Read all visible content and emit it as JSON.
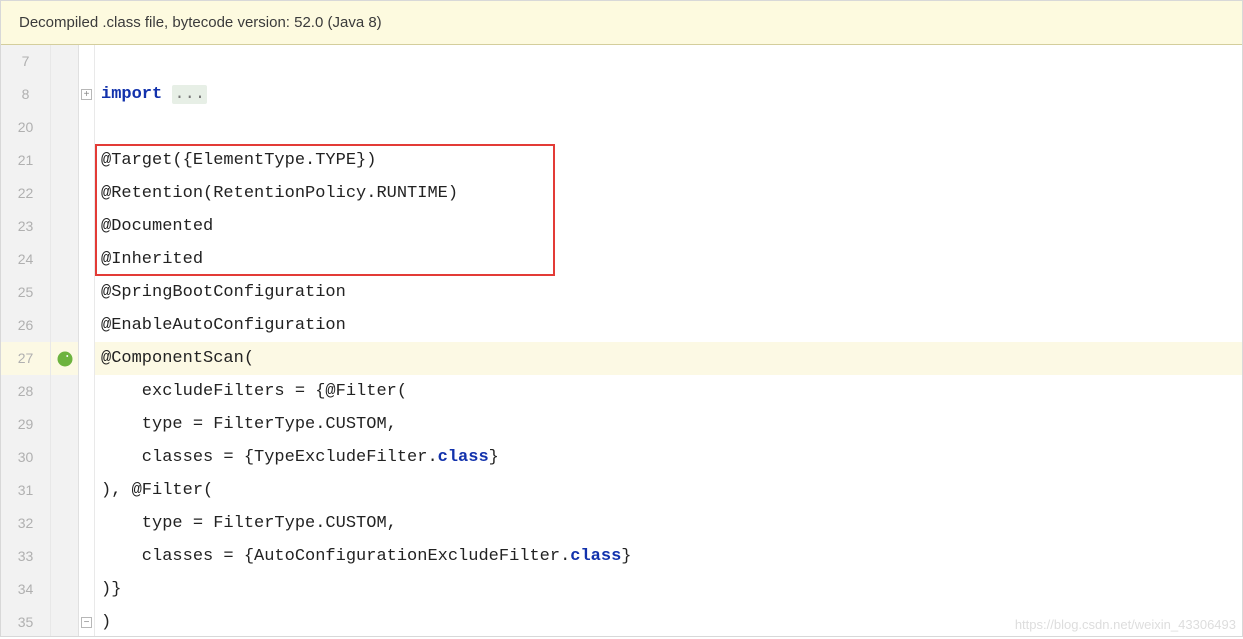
{
  "banner": {
    "text": "Decompiled .class file, bytecode version: 52.0 (Java 8)"
  },
  "lineNumbers": [
    "7",
    "8",
    "20",
    "21",
    "22",
    "23",
    "24",
    "25",
    "26",
    "27",
    "28",
    "29",
    "30",
    "31",
    "32",
    "33",
    "34",
    "35"
  ],
  "code": {
    "l7": "",
    "l8_kw": "import",
    "l8_dots": "...",
    "l20": "",
    "l21": "@Target({ElementType.TYPE})",
    "l22": "@Retention(RetentionPolicy.RUNTIME)",
    "l23": "@Documented",
    "l24": "@Inherited",
    "l25": "@SpringBootConfiguration",
    "l26": "@EnableAutoConfiguration",
    "l27": "@ComponentScan(",
    "l28": "    excludeFilters = {@Filter(",
    "l29": "    type = FilterType.CUSTOM,",
    "l30a": "    classes = {TypeExcludeFilter.",
    "l30b": "class",
    "l30c": "}",
    "l31": "), @Filter(",
    "l32": "    type = FilterType.CUSTOM,",
    "l33a": "    classes = {AutoConfigurationExcludeFilter.",
    "l33b": "class",
    "l33c": "}",
    "l34": ")}",
    "l35": ")"
  },
  "watermark": "https://blog.csdn.net/weixin_43306493"
}
